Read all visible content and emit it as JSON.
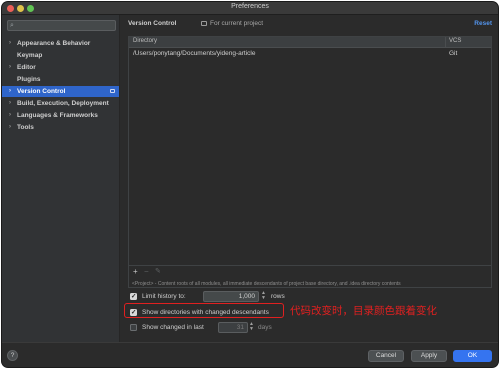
{
  "window": {
    "title": "Preferences"
  },
  "sidebar": {
    "search_placeholder": "",
    "items": [
      {
        "label": "Appearance & Behavior",
        "arrow": "›",
        "selected": false
      },
      {
        "label": "Keymap",
        "arrow": "",
        "selected": false
      },
      {
        "label": "Editor",
        "arrow": "›",
        "selected": false
      },
      {
        "label": "Plugins",
        "arrow": "",
        "selected": false
      },
      {
        "label": "Version Control",
        "arrow": "›",
        "selected": true
      },
      {
        "label": "Build, Execution, Deployment",
        "arrow": "›",
        "selected": false
      },
      {
        "label": "Languages & Frameworks",
        "arrow": "›",
        "selected": false
      },
      {
        "label": "Tools",
        "arrow": "›",
        "selected": false
      }
    ]
  },
  "main": {
    "title": "Version Control",
    "scope": "For current project",
    "reset_label": "Reset",
    "table": {
      "columns": [
        "Directory",
        "VCS"
      ],
      "rows": [
        {
          "directory": "/Users/ponytang/Documents/yideng-article",
          "vcs": "Git"
        }
      ]
    },
    "toolbar": {
      "add": "+",
      "remove": "−",
      "edit": "✎"
    },
    "hint": "<Project> - Content roots of all modules, all immediate descendants of project base directory, and .idea directory contents",
    "options": {
      "limit_history": {
        "label": "Limit history to:",
        "checked": true,
        "value": "1,000",
        "unit": "rows"
      },
      "show_directories": {
        "label": "Show directories with changed descendants",
        "checked": true
      },
      "show_changed": {
        "label": "Show changed in last",
        "checked": false,
        "value": "31",
        "unit": "days"
      }
    },
    "annotation": "代码改变时，目录颜色跟着变化",
    "highlight_color": "#e02020"
  },
  "footer": {
    "help": "?",
    "cancel": "Cancel",
    "apply": "Apply",
    "ok": "OK"
  },
  "colors": {
    "selected": "#2f65ca",
    "ok_button": "#3574f0",
    "link": "#5394ec"
  }
}
